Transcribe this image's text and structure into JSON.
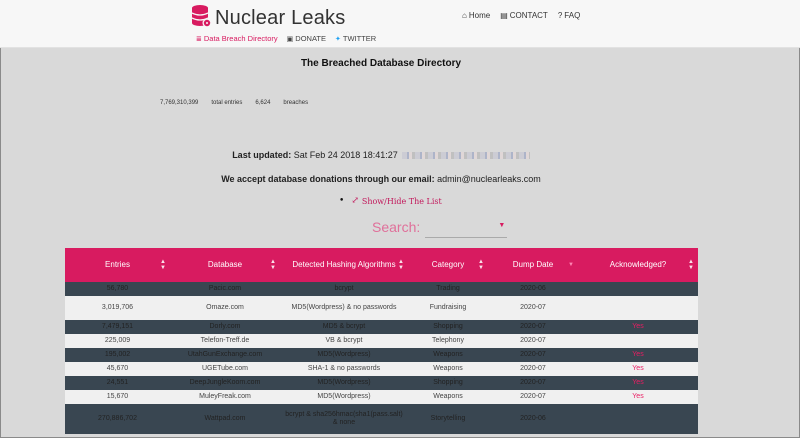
{
  "header": {
    "logo_text": "Nuclear Leaks",
    "nav": [
      {
        "label": "Home",
        "icon": "home-icon"
      },
      {
        "label": "CONTACT",
        "icon": "contact-card-icon"
      },
      {
        "label": "FAQ",
        "icon": "question-circle-icon"
      }
    ],
    "subnav": [
      {
        "label": "Data Breach Directory",
        "icon": "database-icon"
      },
      {
        "label": "DONATE",
        "icon": "money-icon"
      },
      {
        "label": "TWITTER",
        "icon": "twitter-icon"
      }
    ]
  },
  "main": {
    "title": "The Breached Database Directory",
    "stats": {
      "entries_value": "7,769,310,399",
      "entries_label": "total entries",
      "breaches_value": "6,624",
      "breaches_label": "breaches"
    },
    "last_updated_label": "Last updated:",
    "last_updated_value": "Sat Feb 24 2018 18:41:27",
    "donations_label": "We accept database donations through our email:",
    "donations_email": "admin@nuclearleaks.com",
    "toggle_label": "Show/Hide The List",
    "search_label": "Search:"
  },
  "table": {
    "columns": [
      "Entries",
      "Database",
      "Detected Hashing Algorithms",
      "Category",
      "Dump Date",
      "Acknowledged?"
    ],
    "rows": [
      {
        "entries": "56,780",
        "database": "Pacic.com",
        "hash": "bcrypt",
        "category": "Trading",
        "dump": "2020-06",
        "ack": ""
      },
      {
        "entries": "3,019,706",
        "database": "Omaze.com",
        "hash": "MD5(Wordpress) & no passwords",
        "category": "Fundraising",
        "dump": "2020-07",
        "ack": ""
      },
      {
        "entries": "7,479,151",
        "database": "Dorly.com",
        "hash": "MD5 & bcrypt",
        "category": "Shopping",
        "dump": "2020-07",
        "ack": "Yes"
      },
      {
        "entries": "225,009",
        "database": "Telefon-Treff.de",
        "hash": "VB & bcrypt",
        "category": "Telephony",
        "dump": "2020-07",
        "ack": ""
      },
      {
        "entries": "195,002",
        "database": "UtahGunExchange.com",
        "hash": "MD5(Wordpress)",
        "category": "Weapons",
        "dump": "2020-07",
        "ack": "Yes"
      },
      {
        "entries": "45,670",
        "database": "UGETube.com",
        "hash": "SHA-1 & no passwords",
        "category": "Weapons",
        "dump": "2020-07",
        "ack": "Yes"
      },
      {
        "entries": "24,551",
        "database": "DeepJungleKoom.com",
        "hash": "MD5(Wordpress)",
        "category": "Shopping",
        "dump": "2020-07",
        "ack": "Yes"
      },
      {
        "entries": "15,670",
        "database": "MuleyFreak.com",
        "hash": "MD5(Wordpress)",
        "category": "Weapons",
        "dump": "2020-07",
        "ack": "Yes"
      },
      {
        "entries": "270,886,702",
        "database": "Wattpad.com",
        "hash": "bcrypt & sha256hmac(sha1(pass.salt) & none",
        "category": "Storytelling",
        "dump": "2020-06",
        "ack": ""
      }
    ]
  },
  "colors": {
    "accent": "#d81b60",
    "dark_row": "#394651",
    "light_row": "#f0f0f0",
    "page_bg": "#d9d9d9"
  }
}
